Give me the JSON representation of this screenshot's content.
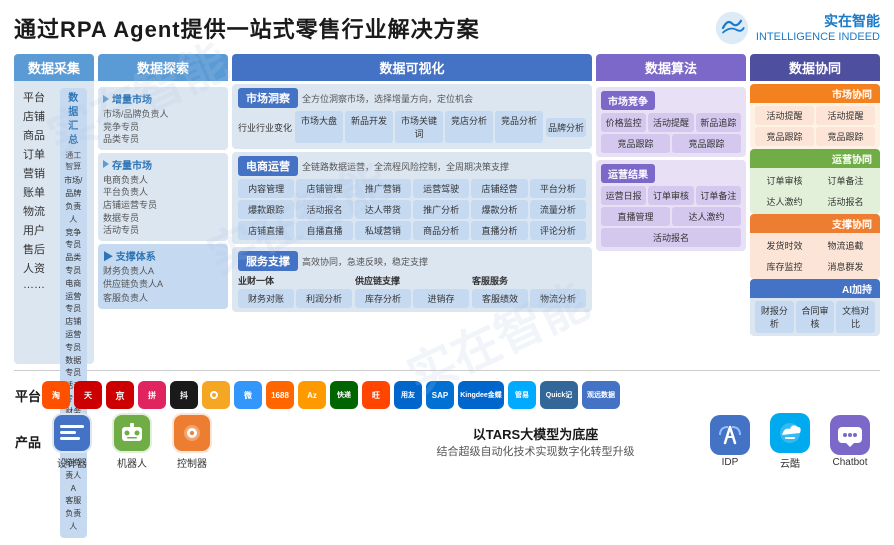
{
  "header": {
    "title": "通过RPA Agent提供一站式零售行业解决方案",
    "logo_line1": "实在智能",
    "logo_line2": "INTELLIGENCE INDEED"
  },
  "columns": {
    "data_collect": {
      "header": "数据采集",
      "items": [
        "平台",
        "店铺",
        "商品",
        "订单",
        "营销",
        "账单",
        "物流",
        "用户",
        "售后",
        "人资",
        "……"
      ],
      "center_title": "数据汇总",
      "center_sub": "通工智算\n市场/品牌负责人\n竞争专员\n品类专员\n电商运营专员\n店铺运营专员\n数据专员\n活动专员\n财务负责人\n供应链负责人A\n客服负责人"
    },
    "data_explore": {
      "header": "数据探索",
      "sections": [
        {
          "title": "增量市场",
          "sub": "市场/品牌负责人\n竞争专员\n品类专员"
        },
        {
          "title": "存量市场",
          "sub": "电商负责人\n平台负责人\n店铺运营专员\n数据专员\n活动专员"
        }
      ],
      "bottom": {
        "title": "▶ 支撑体系",
        "sub": "财务负责人A\n供应链负责人A\n客服负责人"
      }
    },
    "data_visual": {
      "header": "数据可视化",
      "sections": [
        {
          "title": "市场洞察",
          "desc": "全方位洞察市场，选择增量方向，定位机会",
          "row1_title": "行业行业变化",
          "cells_row1": [
            "市场大盘",
            "新品开发",
            "市场关键词",
            "竞店分析",
            "竞品分析",
            "品牌分析"
          ]
        },
        {
          "title": "电商运营",
          "desc": "全链路数据运营，全流程风险控制，全周期决策支撑",
          "row1_cells": [
            "内容管理",
            "店铺管理",
            "推广营销",
            "运营驾驶",
            "店铺经营",
            "平台分析"
          ],
          "row2_cells": [
            "爆款跟踪",
            "活动报名",
            "达人带货",
            "推广分析",
            "爆款分析",
            "流量分析"
          ],
          "row3_cells": [
            "店铺直播",
            "自播直播",
            "私域营销",
            "商品分析",
            "直播分析",
            "评论分析"
          ]
        },
        {
          "title": "服务支撑",
          "desc": "高效协同，急速反映，稳定支撑",
          "subsections": [
            "业财一体",
            "供应链支撑",
            "客服服务"
          ],
          "cells": [
            "财务对账",
            "利润分析",
            "库存分析",
            "进销存",
            "客服绩效",
            "物流分析"
          ]
        }
      ]
    },
    "data_algo": {
      "header": "数据算法",
      "sections": [
        {
          "title": "市场竞争",
          "cells": [
            "价格监控",
            "活动提醒",
            "新品追踪",
            "竞品跟踪",
            "竞品跟踪"
          ]
        },
        {
          "title": "运营结果",
          "cells": [
            "运营日报",
            "订单审核",
            "直播管理",
            "达人激约",
            "活动报名"
          ]
        }
      ]
    },
    "data_collab": {
      "header": "数据协同",
      "sections": [
        {
          "title": "市场协同",
          "color": "orange",
          "cells": [
            "活动提醒",
            "活动提醒",
            "竞品跟踪",
            "竞品跟踪"
          ]
        },
        {
          "title": "运营协同",
          "color": "green",
          "cells": [
            "订单审核",
            "订单备注",
            "达人激约",
            "活动报名"
          ]
        },
        {
          "title": "支撑协同",
          "color": "orange2",
          "cells": [
            "发货时效",
            "物流追截",
            "库存监控",
            "消息群发"
          ]
        },
        {
          "title": "AI加持",
          "color": "blue",
          "cells": [
            "财报分析",
            "合同审核",
            "文档对比"
          ]
        }
      ]
    }
  },
  "platform": {
    "label": "平台",
    "icons": [
      {
        "name": "淘宝",
        "color": "#ff5000",
        "text": "淘"
      },
      {
        "name": "天猫",
        "color": "#ff4400",
        "text": "天"
      },
      {
        "name": "京东",
        "color": "#cc0000",
        "text": "京"
      },
      {
        "name": "拼多多",
        "color": "#e02460",
        "text": "拼"
      },
      {
        "name": "抖音",
        "color": "#000000",
        "text": "抖"
      },
      {
        "name": "快手",
        "color": "#ffb700",
        "text": "快"
      },
      {
        "name": "微店",
        "color": "#3296fa",
        "text": "微"
      },
      {
        "name": "1688",
        "color": "#ff6600",
        "text": "88"
      },
      {
        "name": "亚马逊",
        "color": "#ff9900",
        "text": "Az"
      },
      {
        "name": "快递",
        "color": "#006400",
        "text": "快递"
      },
      {
        "name": "旺旺",
        "color": "#ff4444",
        "text": "旺"
      },
      {
        "name": "用友",
        "color": "#0066cc",
        "text": "用友"
      },
      {
        "name": "SAP",
        "color": "#0070d2",
        "text": "SAP"
      },
      {
        "name": "金蝶",
        "color": "#0066cc",
        "text": "金蝶"
      },
      {
        "name": "管易",
        "color": "#00aaff",
        "text": "管易"
      },
      {
        "name": "Quick",
        "color": "#336699",
        "text": "Q"
      },
      {
        "name": "观远数据",
        "color": "#4472c4",
        "text": "观远"
      }
    ]
  },
  "product": {
    "label": "产品",
    "items": [
      {
        "name": "设计器",
        "color": "#4472c4"
      },
      {
        "name": "机器人",
        "color": "#70ad47"
      },
      {
        "name": "控制器",
        "color": "#ed7d31"
      }
    ],
    "tars_title": "以TARS大模型为底座",
    "tars_sub": "结合超级自动化技术实现数字化转型升级",
    "right_items": [
      {
        "name": "IDP",
        "color": "#4472c4"
      },
      {
        "name": "云酷",
        "color": "#00aaee"
      },
      {
        "name": "Chatbot",
        "color": "#7b68c8"
      }
    ]
  }
}
